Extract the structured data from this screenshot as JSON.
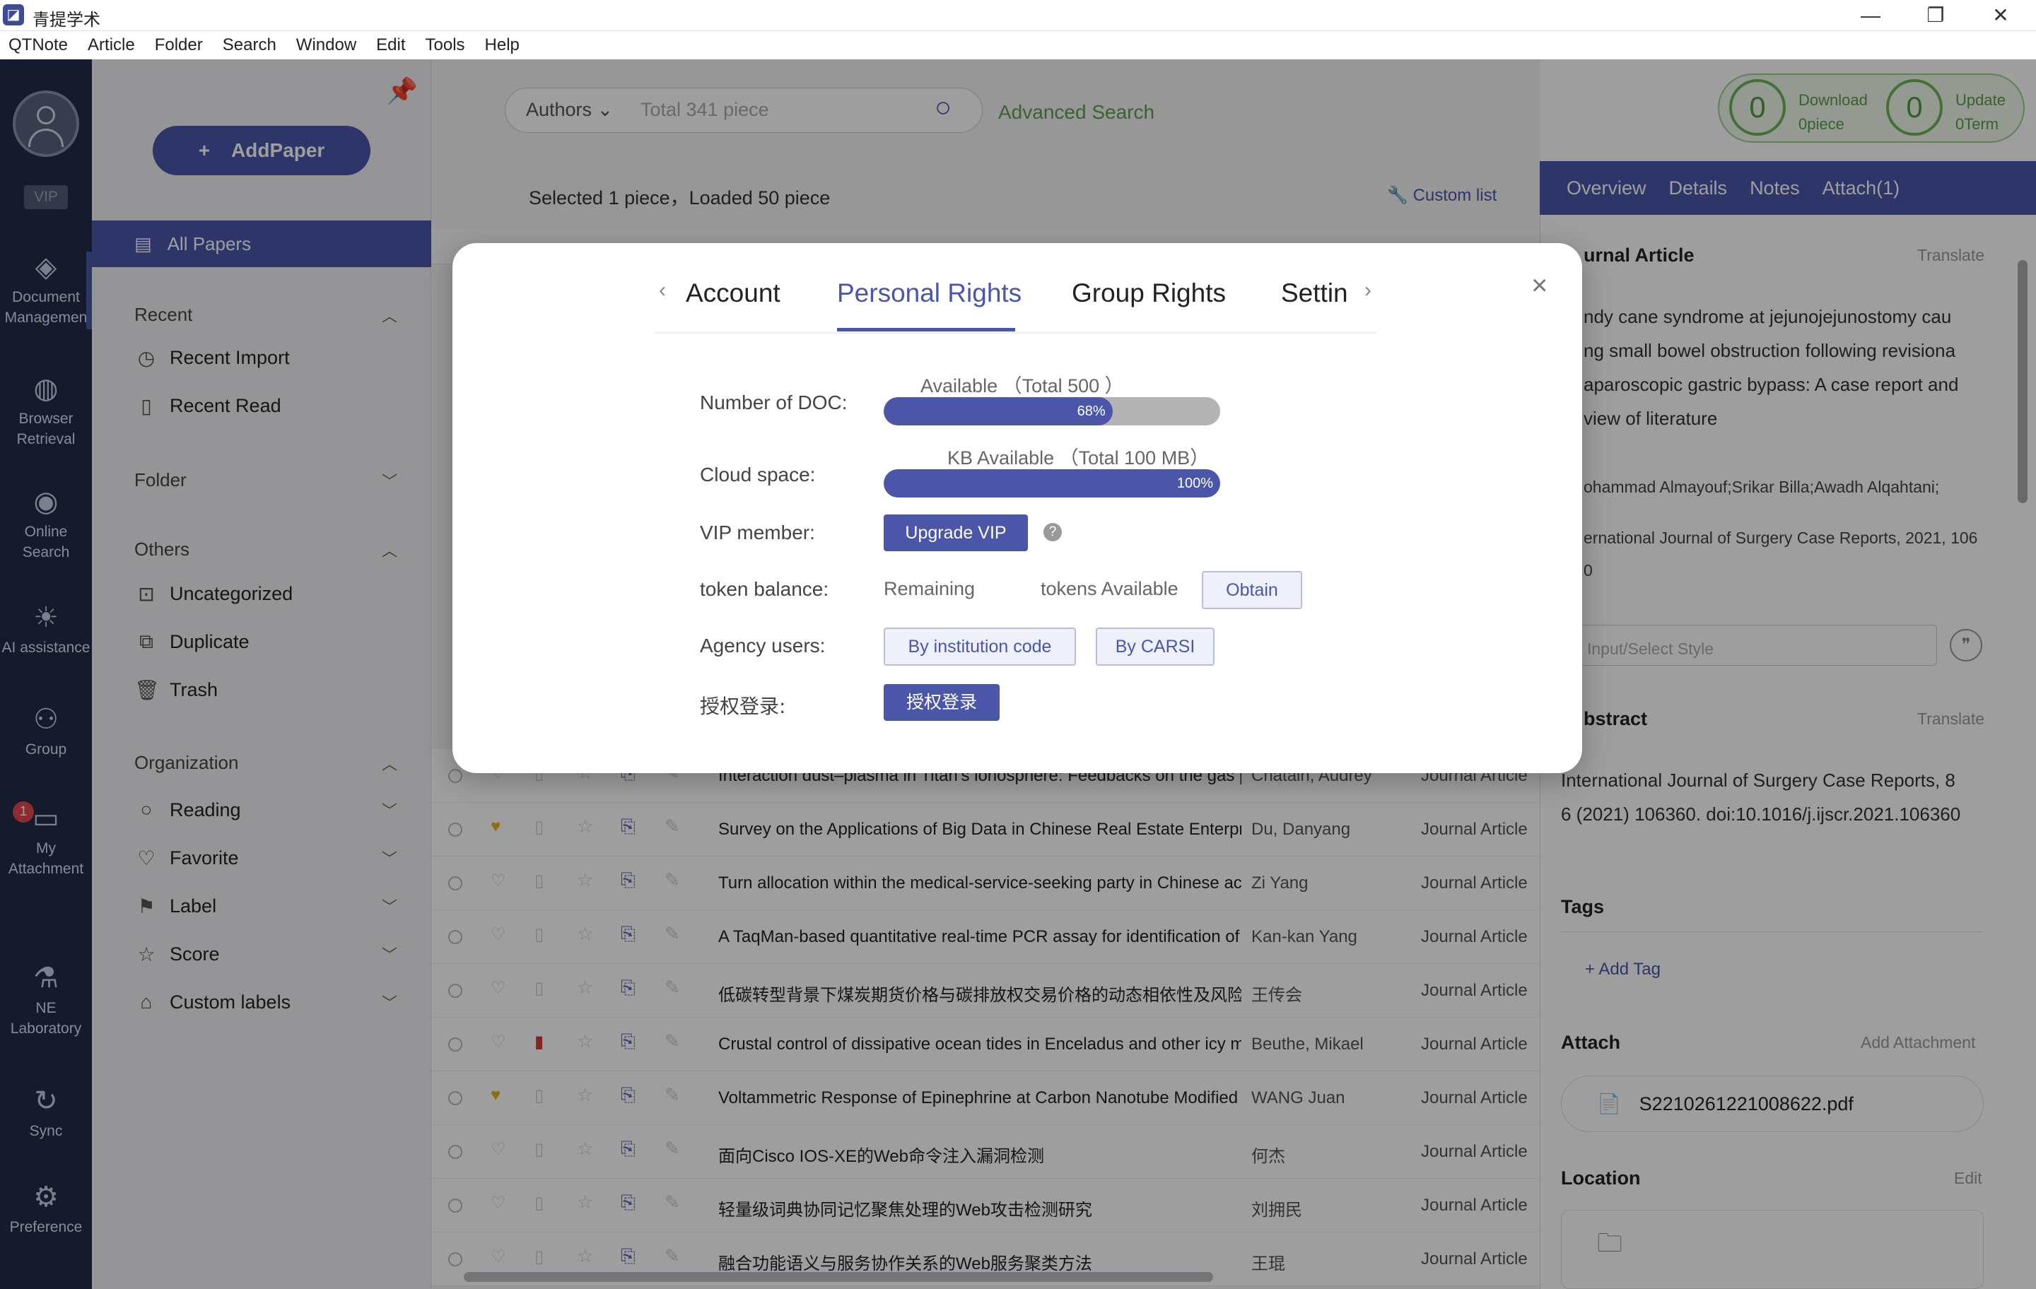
{
  "app": {
    "title": "青提学术",
    "logo_glyph": "◪"
  },
  "window_controls": {
    "minimize": "—",
    "maximize": "❐",
    "close": "✕"
  },
  "menu": [
    "QTNote",
    "Article",
    "Folder",
    "Search",
    "Window",
    "Edit",
    "Tools",
    "Help"
  ],
  "rail": {
    "vip": "VIP",
    "items": [
      {
        "icon": "cube-icon",
        "glyph": "◈",
        "label": "Document Managemen"
      },
      {
        "icon": "globe-icon",
        "glyph": "◍",
        "label": "Browser Retrieval"
      },
      {
        "icon": "eye-icon",
        "glyph": "◉",
        "label": "Online Search"
      },
      {
        "icon": "bulb-icon",
        "glyph": "☀",
        "label": "AI assistance"
      },
      {
        "icon": "group-icon",
        "glyph": "⚇",
        "label": "Group"
      },
      {
        "icon": "attachment-folder-icon",
        "glyph": "▭",
        "label": "My Attachment",
        "badge": "1"
      },
      {
        "icon": "microscope-icon",
        "glyph": "⚗",
        "label": "NE Laboratory"
      },
      {
        "icon": "sync-icon",
        "glyph": "↻",
        "label": "Sync"
      },
      {
        "icon": "gear-icon",
        "glyph": "⚙",
        "label": "Preference"
      }
    ]
  },
  "left": {
    "pin_glyph": "📌",
    "add_paper": "AddPaper",
    "add_glyph": "+",
    "all_papers": "All Papers",
    "recent": "Recent",
    "recent_import": "Recent Import",
    "recent_read": "Recent Read",
    "folder": "Folder",
    "others": "Others",
    "uncategorized": "Uncategorized",
    "duplicate": "Duplicate",
    "trash": "Trash",
    "organization": "Organization",
    "reading": "Reading",
    "favorite": "Favorite",
    "label": "Label",
    "score": "Score",
    "custom_labels": "Custom labels"
  },
  "search": {
    "field": "Authors",
    "placeholder": "Total 341 piece",
    "advanced": "Advanced Search"
  },
  "download": {
    "count": "0",
    "label": "Download",
    "sub": "0piece"
  },
  "update": {
    "count": "0",
    "label": "Update",
    "sub": "0Term"
  },
  "list": {
    "selection": "Selected 1 piece，Loaded 50 piece",
    "custom_list": "Custom list",
    "rows": [
      {
        "title": "Interaction dust–plasma in Titan's ionosphere: Feedbacks on the gas p",
        "author": "Chatain, Audrey",
        "type": "Journal Article"
      },
      {
        "title": "Survey on the Applications of Big Data in Chinese Real Estate Enterpri",
        "author": "Du, Danyang",
        "type": "Journal Article"
      },
      {
        "title": "Turn allocation within the medical-service-seeking party in Chinese ac",
        "author": "Zi Yang",
        "type": "Journal Article"
      },
      {
        "title": "A TaqMan-based quantitative real-time PCR assay for identification of",
        "author": "Kan-kan Yang",
        "type": "Journal Article"
      },
      {
        "title": "低碳转型背景下煤炭期货价格与碳排放权交易价格的动态相依性及风险",
        "author": "王传会",
        "type": "Journal Article"
      },
      {
        "title": "Crustal control of dissipative ocean tides in Enceladus and other icy m",
        "author": "Beuthe, Mikael",
        "type": "Journal Article"
      },
      {
        "title": "Voltammetric Response of Epinephrine at Carbon Nanotube Modified",
        "author": "WANG Juan",
        "type": "Journal Article"
      },
      {
        "title": "面向Cisco IOS-XE的Web命令注入漏洞检测",
        "author": "何杰",
        "type": "Journal Article"
      },
      {
        "title": "轻量级词典协同记忆聚焦处理的Web攻击检测研究",
        "author": "刘拥民",
        "type": "Journal Article"
      },
      {
        "title": "融合功能语义与服务协作关系的Web服务聚类方法",
        "author": "王琨",
        "type": "Journal Article"
      }
    ]
  },
  "right": {
    "tabs": [
      "Overview",
      "Details",
      "Notes",
      "Attach(1)"
    ],
    "type_heading": "urnal Article",
    "translate": "Translate",
    "title_lines": [
      "ndy cane syndrome at jejunojejunostomy cau",
      "ng small bowel obstruction following revisiona",
      "aparoscopic gastric bypass: A case report and",
      "view of literature"
    ],
    "authors": "ohammad Almayouf;Srikar Billa;Awadh Alqahtani;",
    "journal": "ernational Journal of Surgery Case Reports, 2021, 106",
    "journal_cont": "0",
    "style_placeholder": "Input/Select Style",
    "quote_glyph": "❞",
    "abstract_heading": "bstract",
    "abstract_lines": [
      "International Journal of Surgery Case Reports, 8",
      "6 (2021) 106360. doi:10.1016/j.ijscr.2021.106360"
    ],
    "tags_heading": "Tags",
    "add_tag": "+ Add Tag",
    "attach_heading": "Attach",
    "add_attachment": "Add Attachment",
    "file_name": "S2210261221008622.pdf",
    "pdf_glyph": "📄",
    "location_heading": "Location",
    "edit": "Edit",
    "folder_glyph": "🗀"
  },
  "modal": {
    "tabs": [
      "Account",
      "Personal Rights",
      "Group Rights",
      "Settin"
    ],
    "active_tab": "Personal Rights",
    "doc_label": "Number of DOC:",
    "doc_note": "Available （Total 500 ）",
    "doc_percent_text": "68%",
    "doc_percent": 68,
    "cloud_label": "Cloud space:",
    "cloud_note": "KB Available （Total 100 MB）",
    "cloud_percent_text": "100%",
    "cloud_percent": 100,
    "vip_label": "VIP member:",
    "upgrade": "Upgrade VIP",
    "help_glyph": "?",
    "token_label": "token balance:",
    "remaining": "Remaining",
    "tokens_available": "tokens Available",
    "obtain": "Obtain",
    "agency_label": "Agency users:",
    "institution": "By institution code",
    "carsi": "By CARSI",
    "auth_label": "授权登录:",
    "auth_button": "授权登录"
  },
  "colors": {
    "accent": "#4b56a8",
    "rail": "#232a48",
    "green": "#68b84f"
  }
}
